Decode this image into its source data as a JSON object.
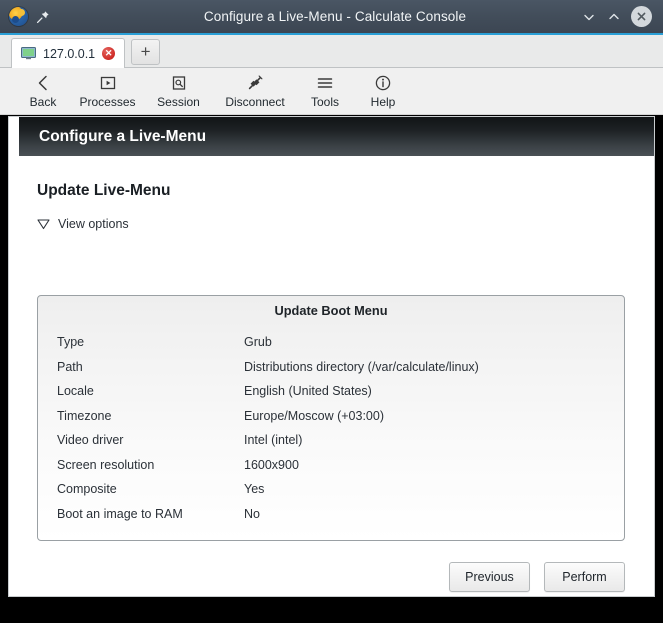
{
  "window": {
    "title": "Configure a Live-Menu - Calculate Console",
    "app_icon": "calculate-logo-icon",
    "pin_icon": "pin-icon",
    "minimize_label": "⌄",
    "maximize_label": "⌃",
    "close_label": "✕",
    "accent_color": "#2a9fd6"
  },
  "tabs": {
    "items": [
      {
        "label": "127.0.0.1",
        "icon": "monitor-icon",
        "close_label": "✕"
      }
    ],
    "new_tab_label": "+"
  },
  "toolbar": {
    "items": [
      {
        "label": "Back",
        "icon": "chevron-left-icon"
      },
      {
        "label": "Processes",
        "icon": "processes-icon"
      },
      {
        "label": "Session",
        "icon": "session-search-icon"
      },
      {
        "label": "Disconnect",
        "icon": "disconnect-plug-icon"
      },
      {
        "label": "Tools",
        "icon": "hamburger-menu-icon"
      },
      {
        "label": "Help",
        "icon": "info-circle-icon"
      }
    ]
  },
  "page": {
    "header_title": "Configure a Live-Menu",
    "section_title": "Update Live-Menu",
    "view_options_label": "View options",
    "view_options_icon": "triangle-down-icon"
  },
  "card": {
    "title": "Update Boot Menu",
    "rows": [
      {
        "label": "Type",
        "value": "Grub"
      },
      {
        "label": "Path",
        "value": "Distributions directory (/var/calculate/linux)"
      },
      {
        "label": "Locale",
        "value": "English (United States)"
      },
      {
        "label": "Timezone",
        "value": "Europe/Moscow (+03:00)"
      },
      {
        "label": "Video driver",
        "value": "Intel (intel)"
      },
      {
        "label": "Screen resolution",
        "value": "1600x900"
      },
      {
        "label": "Composite",
        "value": "Yes"
      },
      {
        "label": "Boot an image to RAM",
        "value": "No"
      }
    ]
  },
  "actions": {
    "previous_label": "Previous",
    "perform_label": "Perform"
  }
}
